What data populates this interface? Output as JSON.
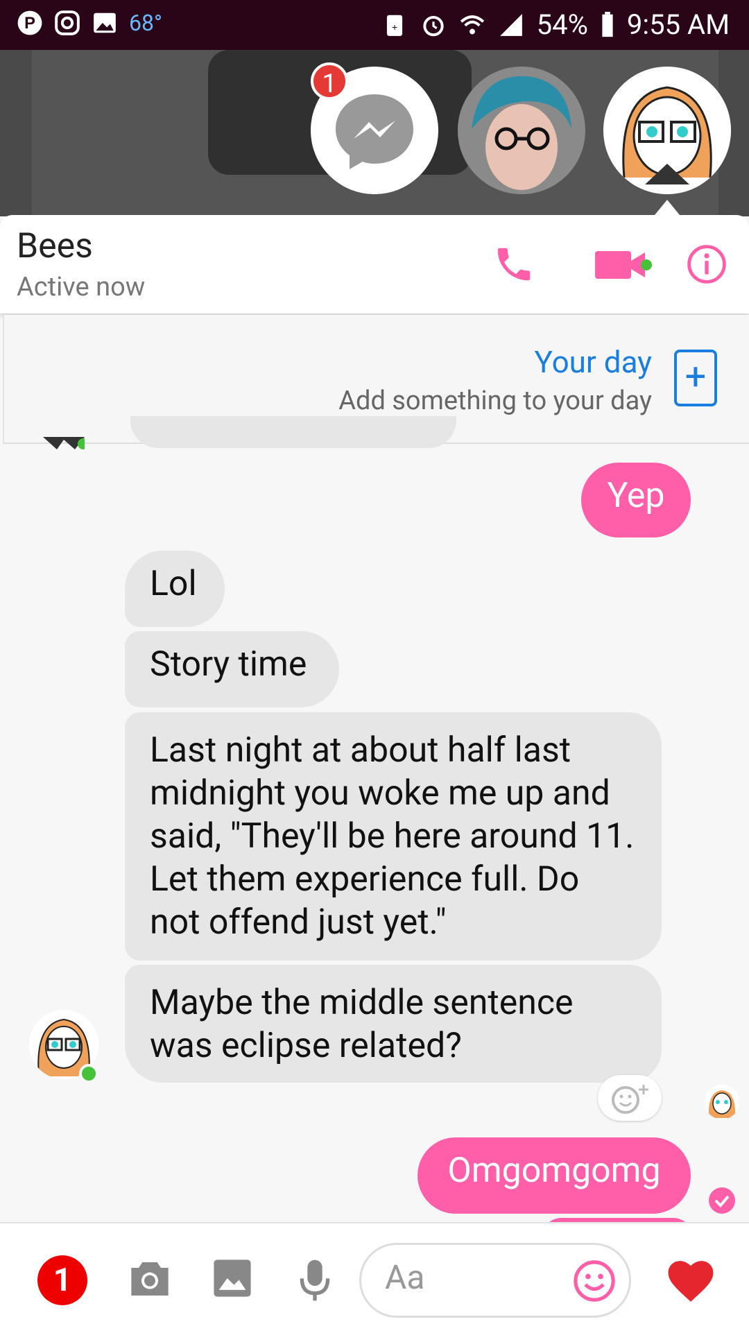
{
  "status_bar": {
    "temperature": "68°",
    "battery": "54%",
    "time": "9:55 AM"
  },
  "chat_heads": {
    "badge_count": "1"
  },
  "header": {
    "contact_name": "Bees",
    "presence": "Active now"
  },
  "your_day": {
    "title": "Your day",
    "subtitle": "Add something to your day"
  },
  "messages": [
    {
      "sender": "me",
      "text": "Yep"
    },
    {
      "sender": "them",
      "text": "Lol"
    },
    {
      "sender": "them",
      "text": "Story time"
    },
    {
      "sender": "them",
      "text": "Last night at about half last midnight you woke me up and said, \"They'll be here around 11. Let them experience full. Do not offend just yet.\""
    },
    {
      "sender": "them",
      "text": "Maybe the middle sentence was eclipse related?"
    },
    {
      "sender": "me",
      "text": "Omgomgomg"
    }
  ],
  "composer": {
    "badge_count": "1",
    "placeholder": "Aa"
  },
  "colors": {
    "accent": "#ff5fa8",
    "link": "#1a7ee0",
    "online": "#46c23a"
  },
  "icons": [
    "pinterest-icon",
    "instagram-icon",
    "gallery-icon",
    "alarm-icon",
    "wifi-icon",
    "signal-icon",
    "battery-icon",
    "messenger-icon",
    "phone-icon",
    "video-icon",
    "info-icon",
    "add-icon",
    "reaction-icon",
    "camera-icon",
    "image-icon",
    "microphone-icon",
    "emoji-icon",
    "heart-icon",
    "check-icon"
  ]
}
